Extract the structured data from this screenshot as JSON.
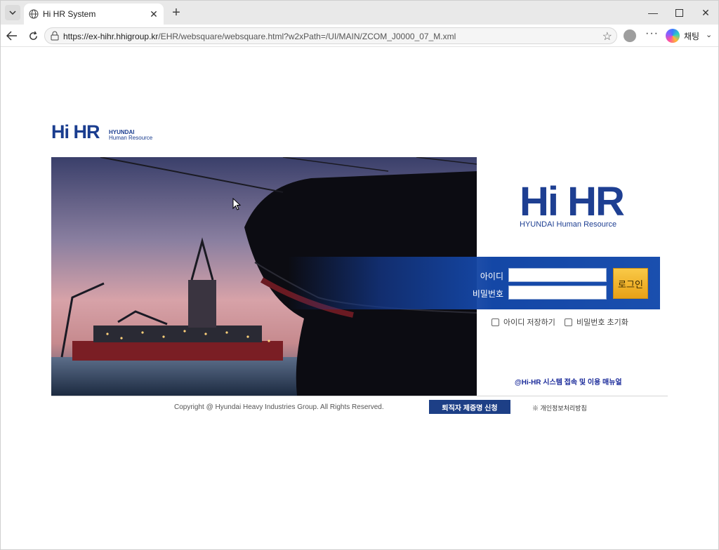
{
  "browser": {
    "tab_title": "Hi HR System",
    "url_host": "https://ex-hihr.hhigroup.kr",
    "url_path": "/EHR/websquare/websquare.html?w2xPath=/UI/MAIN/ZCOM_J0000_07_M.xml",
    "copilot_label": "채팅"
  },
  "header_logo": {
    "mark": "Hi HR",
    "line1": "HYUNDAI",
    "line2": "Human Resource"
  },
  "login_logo": {
    "mark": "Hi HR",
    "subtitle": "HYUNDAI Human Resource"
  },
  "login": {
    "id_label": "아이디",
    "pw_label": "비밀번호",
    "id_value": "",
    "pw_value": "",
    "login_button": "로그인",
    "save_id": "아이디 저장하기",
    "reset_pw": "비밀번호 초기화"
  },
  "manual_link": "@Hi-HR 시스템 접속 및 이용 매뉴얼",
  "footer": {
    "copyright": "Copyright @ Hyundai Heavy Industries Group. All Rights Reserved.",
    "cert_button": "퇴직자 제증명 신청",
    "privacy": "※ 개인정보처리방침"
  },
  "colors": {
    "brand_blue": "#1e3f92",
    "login_band": "#1447a6",
    "login_button": "#f0b630"
  }
}
